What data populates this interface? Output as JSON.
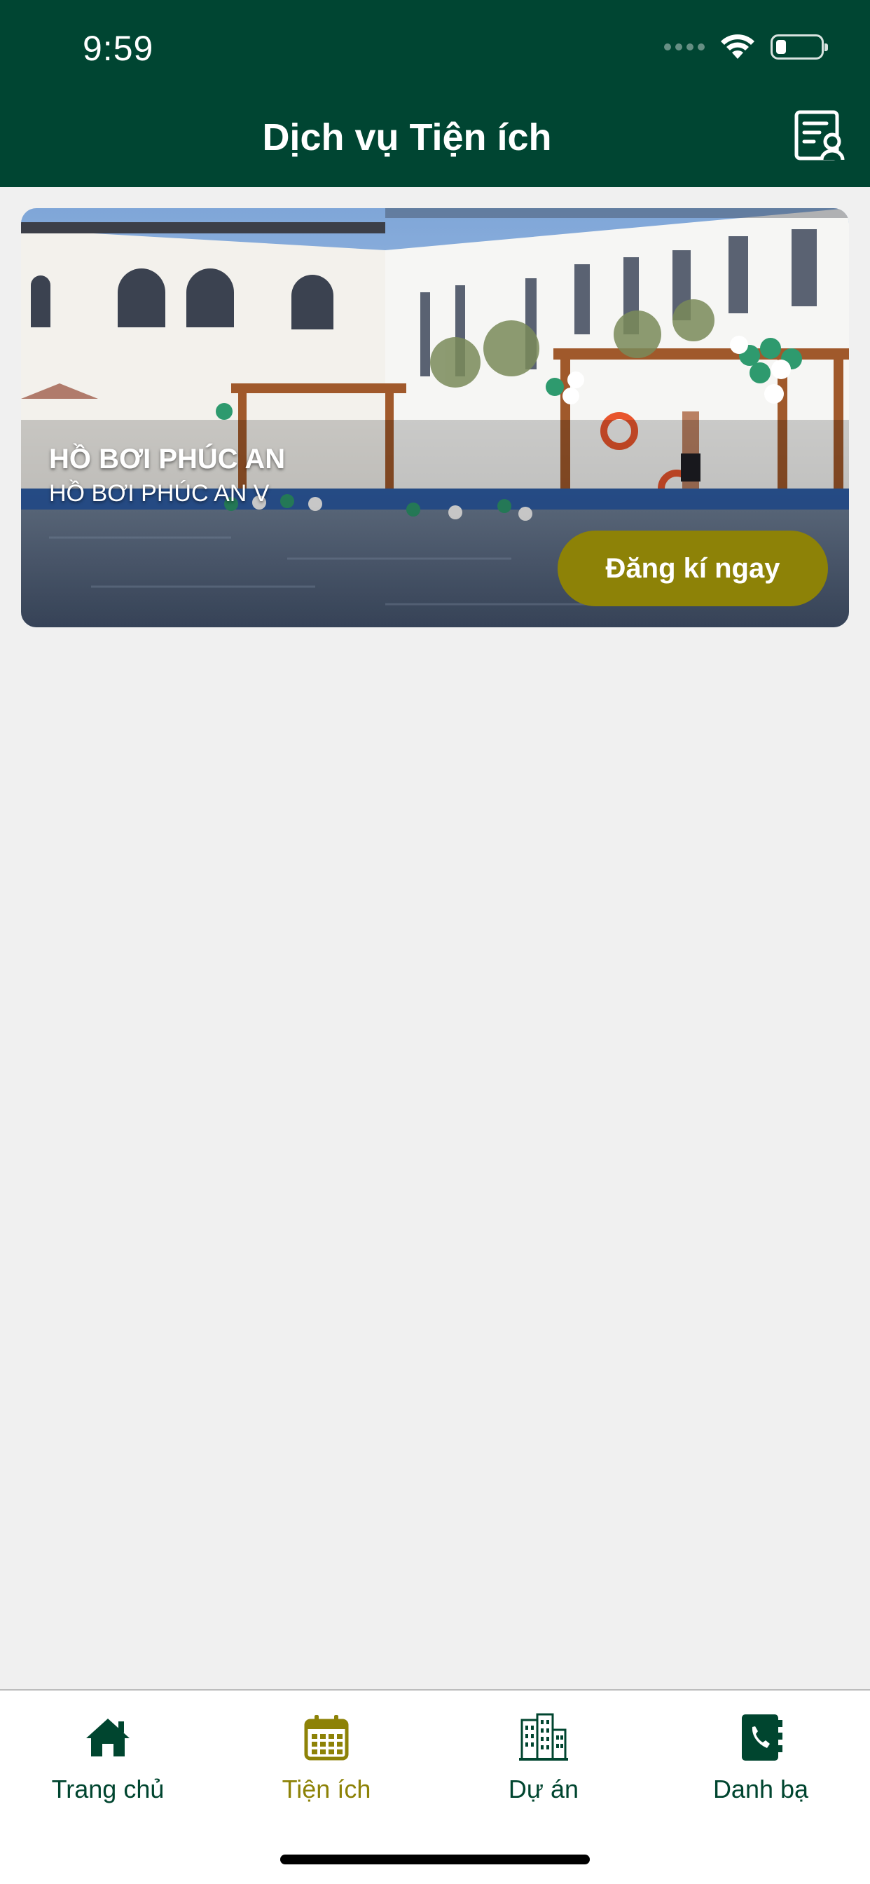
{
  "status_bar": {
    "time": "9:59"
  },
  "header": {
    "title": "Dịch vụ Tiện ích"
  },
  "services": [
    {
      "title": "HỒ BƠI PHÚC AN",
      "subtitle": "HỒ BƠI PHÚC AN V",
      "button_label": "Đăng kí ngay"
    }
  ],
  "tabbar": {
    "items": [
      {
        "label": "Trang chủ",
        "icon": "home-icon",
        "active": false
      },
      {
        "label": "Tiện ích",
        "icon": "calendar-icon",
        "active": true
      },
      {
        "label": "Dự án",
        "icon": "buildings-icon",
        "active": false
      },
      {
        "label": "Danh bạ",
        "icon": "phone-book-icon",
        "active": false
      }
    ]
  },
  "colors": {
    "header_bg": "#004532",
    "accent": "#8d8207",
    "tab_inactive": "#00452f",
    "page_bg": "#f0f0f0"
  }
}
